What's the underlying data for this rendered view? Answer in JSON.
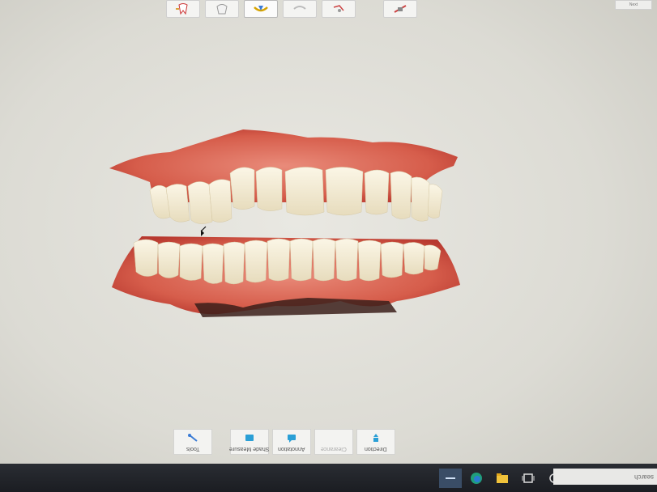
{
  "top_toolbar": {
    "tools": [
      {
        "icon": "tooth-arrows-icon"
      },
      {
        "icon": "crown-icon"
      },
      {
        "icon": "jaw-icon",
        "active": true
      },
      {
        "icon": "bite-icon"
      },
      {
        "icon": "antagonist-icon"
      },
      {
        "icon": "measure-icon"
      }
    ],
    "right_label": "Next"
  },
  "bottom_toolbar": {
    "items": [
      {
        "label": "Tools",
        "icon": "tools-icon",
        "enabled": true
      },
      {
        "label": "Shade Measure",
        "icon": "shade-measure-icon",
        "enabled": true
      },
      {
        "label": "Annotation",
        "icon": "annotation-icon",
        "enabled": true
      },
      {
        "label": "Clearance",
        "icon": "clearance-icon",
        "enabled": false
      },
      {
        "label": "Direction",
        "icon": "direction-icon",
        "enabled": true
      }
    ]
  },
  "taskbar": {
    "search_text": "search"
  },
  "colors": {
    "gum": "#d9624f",
    "tooth": "#f3ecd7",
    "taskbar": "#202328",
    "accent": "#2a9fd6"
  }
}
